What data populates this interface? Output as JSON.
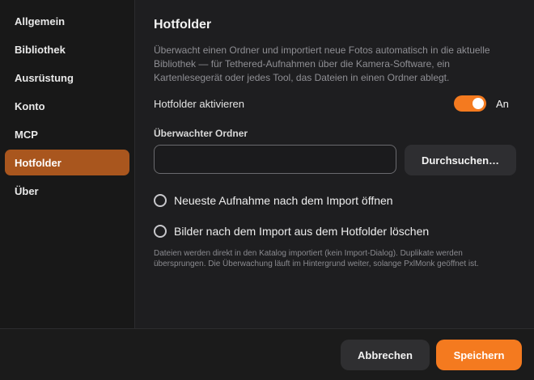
{
  "sidebar": {
    "items": [
      {
        "label": "Allgemein"
      },
      {
        "label": "Bibliothek"
      },
      {
        "label": "Ausrüstung"
      },
      {
        "label": "Konto"
      },
      {
        "label": "MCP"
      },
      {
        "label": "Hotfolder",
        "active": true
      },
      {
        "label": "Über"
      }
    ]
  },
  "main": {
    "title": "Hotfolder",
    "description": "Überwacht einen Ordner und importiert neue Fotos automatisch in die aktuelle Bibliothek — für Tethered-Aufnahmen über die Kamera-Software, ein Kartenlesegerät oder jedes Tool, das Dateien in einen Ordner ablegt.",
    "toggle": {
      "label": "Hotfolder aktivieren",
      "state": "An",
      "enabled": true
    },
    "folder": {
      "label": "Überwachter Ordner",
      "value": "",
      "browse_label": "Durchsuchen…"
    },
    "options": [
      {
        "label": "Neueste Aufnahme nach dem Import öffnen",
        "checked": false
      },
      {
        "label": "Bilder nach dem Import aus dem Hotfolder löschen",
        "checked": false
      }
    ],
    "note": "Dateien werden direkt in den Katalog importiert (kein Import-Dialog). Duplikate werden übersprungen. Die Überwachung läuft im Hintergrund weiter, solange PxlMonk geöffnet ist."
  },
  "footer": {
    "cancel_label": "Abbrechen",
    "save_label": "Speichern"
  },
  "colors": {
    "accent": "#f47a1f",
    "sidebar_active": "#a9561e",
    "background": "#1e1e20"
  }
}
